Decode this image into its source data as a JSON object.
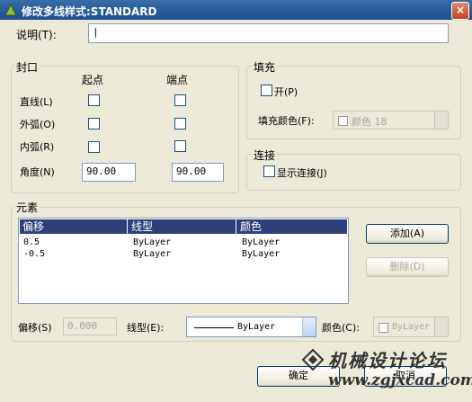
{
  "window": {
    "title": "修改多线样式:STANDARD",
    "close_label": "×"
  },
  "description": {
    "label": "说明(T):",
    "value": "|"
  },
  "caps": {
    "title": "封口",
    "start_header": "起点",
    "end_header": "端点",
    "line_label": "直线(L)",
    "outer_arc_label": "外弧(O)",
    "inner_arc_label": "内弧(R)",
    "angle_label": "角度(N)",
    "start_angle": "90.00",
    "end_angle": "90.00"
  },
  "fill": {
    "title": "填充",
    "on_label": "开(P)",
    "color_label": "填充颜色(F):",
    "color_value": "颜色 18"
  },
  "joints": {
    "title": "连接",
    "show_label": "显示连接(J)"
  },
  "elements": {
    "title": "元素",
    "columns": [
      "偏移",
      "线型",
      "颜色"
    ],
    "rows": [
      {
        "offset": "0.5",
        "linetype": "ByLayer",
        "color": "ByLayer"
      },
      {
        "offset": "-0.5",
        "linetype": "ByLayer",
        "color": "ByLayer"
      }
    ],
    "add_label": "添加(A)",
    "delete_label": "删除(D)",
    "offset_label": "偏移(S)",
    "offset_value": "0.000",
    "linetype_label": "线型(E):",
    "linetype_value": "ByLayer",
    "color_label": "颜色(C):",
    "color_value": "ByLayer"
  },
  "footer": {
    "ok_label": "确定",
    "cancel_label": "取消"
  },
  "watermark": {
    "title": "机械设计论坛",
    "url": "www.zgjxcad.com"
  }
}
